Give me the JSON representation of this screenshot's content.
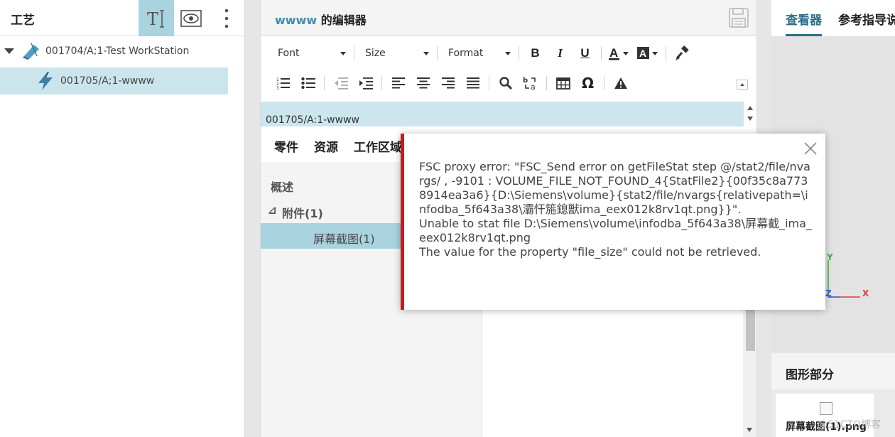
{
  "left_panel": {
    "title": "工艺",
    "tree": [
      {
        "label": "001704/A;1-Test WorkStation",
        "expanded": true,
        "icon": "workstation-icon"
      },
      {
        "label": "001705/A;1-wwww",
        "selected": true,
        "icon": "lightning-icon"
      }
    ],
    "tools": [
      "text-tool-icon",
      "eye-icon",
      "more-icon"
    ]
  },
  "editor": {
    "title_accent": "wwww",
    "title_rest": " 的编辑器",
    "save_icon": "save-icon",
    "font_dropdown": "Font",
    "size_dropdown": "Size",
    "format_dropdown": "Format",
    "content_text": "001705/A:1-wwww",
    "tabs": [
      "零件",
      "资源",
      "工作区域"
    ],
    "side_items": {
      "overview": "概述",
      "attachments": "附件(1)",
      "attachment_toggle": "⊿",
      "attachment_child": "屏幕截图(1)"
    }
  },
  "right_panel": {
    "tabs": [
      "查看器",
      "参考指导说"
    ],
    "axes": {
      "y": "Y",
      "z": "Z",
      "x": "X"
    },
    "shape_header": "图形部分",
    "shape_caption": "屏幕截图(1).png",
    "watermark": "@51CTO博客"
  },
  "error_popup": {
    "message": "FSC proxy error: \"FSC_Send error on getFileStat step @/stat2/file/nvargs/ , -9101 : VOLUME_FILE_NOT_FOUND_4{StatFile2}{00f35c8a7738914ea3a6}{D:\\Siemens\\volume}{stat2/file/nvargs{relativepath=\\infodba_5f643a38\\灞忓箷鎴獣ima_eex012k8rv1qt.png}}\".\nUnable to stat file D:\\Siemens\\volume\\infodba_5f643a38\\屏幕截_ima_eex012k8rv1qt.png\nThe value for the property \"file_size\" could not be retrieved.",
    "color": "#c01f1f"
  }
}
